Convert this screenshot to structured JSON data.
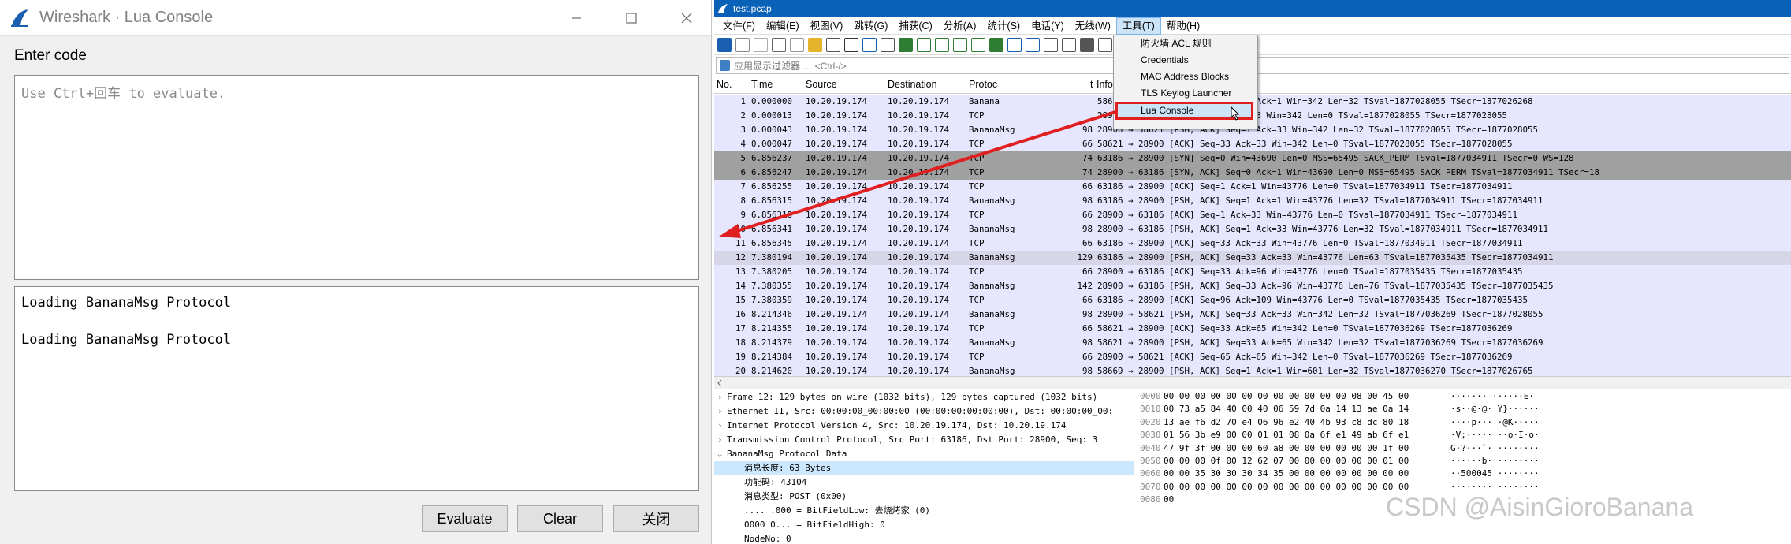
{
  "lua_console": {
    "title": "Wireshark · Lua Console",
    "enter_code_label": "Enter code",
    "code_placeholder": "Use Ctrl+回车 to evaluate.",
    "output_lines": [
      "Loading BananaMsg Protocol",
      "Loading BananaMsg Protocol"
    ],
    "buttons": {
      "evaluate": "Evaluate",
      "clear": "Clear",
      "close": "关闭"
    }
  },
  "wireshark": {
    "title": "test.pcap",
    "menu": [
      "文件(F)",
      "编辑(E)",
      "视图(V)",
      "跳转(G)",
      "捕获(C)",
      "分析(A)",
      "统计(S)",
      "电话(Y)",
      "无线(W)",
      "工具(T)",
      "帮助(H)"
    ],
    "active_menu": "工具(T)",
    "filter_placeholder": "应用显示过滤器 … <Ctrl-/>",
    "tools_menu": [
      "防火墙 ACL 规则",
      "Credentials",
      "MAC Address Blocks",
      "TLS Keylog Launcher",
      "Lua Console"
    ],
    "columns": [
      "No.",
      "Time",
      "Source",
      "Destination",
      "Protoc",
      "t",
      "Info"
    ],
    "packets": [
      {
        "no": "1",
        "time": "0.000000",
        "src": "10.20.19.174",
        "dst": "10.20.19.174",
        "proto": "Banana",
        "len": "",
        "info": "58621 → 28900 [PSH, ACK] Seq=1 Ack=1 Win=342 Len=32 TSval=1877028055 TSecr=1877026268",
        "style": "normal"
      },
      {
        "no": "2",
        "time": "0.000013",
        "src": "10.20.19.174",
        "dst": "10.20.19.174",
        "proto": "TCP",
        "len": "",
        "info": "28900 → 58621 [ACK] Seq=1 Ack=33 Win=342 Len=0 TSval=1877028055 TSecr=1877028055",
        "style": "normal"
      },
      {
        "no": "3",
        "time": "0.000043",
        "src": "10.20.19.174",
        "dst": "10.20.19.174",
        "proto": "BananaMsg",
        "len": "98",
        "info": "28900 → 58621 [PSH, ACK] Seq=1 Ack=33 Win=342 Len=32 TSval=1877028055 TSecr=1877028055",
        "style": "normal"
      },
      {
        "no": "4",
        "time": "0.000047",
        "src": "10.20.19.174",
        "dst": "10.20.19.174",
        "proto": "TCP",
        "len": "66",
        "info": "58621 → 28900 [ACK] Seq=33 Ack=33 Win=342 Len=0 TSval=1877028055 TSecr=1877028055",
        "style": "normal"
      },
      {
        "no": "5",
        "time": "6.856237",
        "src": "10.20.19.174",
        "dst": "10.20.19.174",
        "proto": "TCP",
        "len": "74",
        "info": "63186 → 28900 [SYN] Seq=0 Win=43690 Len=0 MSS=65495 SACK_PERM TSval=1877034911 TSecr=0 WS=128",
        "style": "gray"
      },
      {
        "no": "6",
        "time": "6.856247",
        "src": "10.20.19.174",
        "dst": "10.20.19.174",
        "proto": "TCP",
        "len": "74",
        "info": "28900 → 63186 [SYN, ACK] Seq=0 Ack=1 Win=43690 Len=0 MSS=65495 SACK_PERM TSval=1877034911 TSecr=18",
        "style": "gray"
      },
      {
        "no": "7",
        "time": "6.856255",
        "src": "10.20.19.174",
        "dst": "10.20.19.174",
        "proto": "TCP",
        "len": "66",
        "info": "63186 → 28900 [ACK] Seq=1 Ack=1 Win=43776 Len=0 TSval=1877034911 TSecr=1877034911",
        "style": "normal"
      },
      {
        "no": "8",
        "time": "6.856315",
        "src": "10.20.19.174",
        "dst": "10.20.19.174",
        "proto": "BananaMsg",
        "len": "98",
        "info": "63186 → 28900 [PSH, ACK] Seq=1 Ack=1 Win=43776 Len=32 TSval=1877034911 TSecr=1877034911",
        "style": "normal"
      },
      {
        "no": "9",
        "time": "6.856318",
        "src": "10.20.19.174",
        "dst": "10.20.19.174",
        "proto": "TCP",
        "len": "66",
        "info": "28900 → 63186 [ACK] Seq=1 Ack=33 Win=43776 Len=0 TSval=1877034911 TSecr=1877034911",
        "style": "normal"
      },
      {
        "no": "10",
        "time": "6.856341",
        "src": "10.20.19.174",
        "dst": "10.20.19.174",
        "proto": "BananaMsg",
        "len": "98",
        "info": "28900 → 63186 [PSH, ACK] Seq=1 Ack=33 Win=43776 Len=32 TSval=1877034911 TSecr=1877034911",
        "style": "normal"
      },
      {
        "no": "11",
        "time": "6.856345",
        "src": "10.20.19.174",
        "dst": "10.20.19.174",
        "proto": "TCP",
        "len": "66",
        "info": "63186 → 28900 [ACK] Seq=33 Ack=33 Win=43776 Len=0 TSval=1877034911 TSecr=1877034911",
        "style": "normal"
      },
      {
        "no": "12",
        "time": "7.380194",
        "src": "10.20.19.174",
        "dst": "10.20.19.174",
        "proto": "BananaMsg",
        "len": "129",
        "info": "63186 → 28900 [PSH, ACK] Seq=33 Ack=33 Win=43776 Len=63 TSval=1877035435 TSecr=1877034911",
        "style": "sel"
      },
      {
        "no": "13",
        "time": "7.380205",
        "src": "10.20.19.174",
        "dst": "10.20.19.174",
        "proto": "TCP",
        "len": "66",
        "info": "28900 → 63186 [ACK] Seq=33 Ack=96 Win=43776 Len=0 TSval=1877035435 TSecr=1877035435",
        "style": "normal"
      },
      {
        "no": "14",
        "time": "7.380355",
        "src": "10.20.19.174",
        "dst": "10.20.19.174",
        "proto": "BananaMsg",
        "len": "142",
        "info": "28900 → 63186 [PSH, ACK] Seq=33 Ack=96 Win=43776 Len=76 TSval=1877035435 TSecr=1877035435",
        "style": "normal"
      },
      {
        "no": "15",
        "time": "7.380359",
        "src": "10.20.19.174",
        "dst": "10.20.19.174",
        "proto": "TCP",
        "len": "66",
        "info": "63186 → 28900 [ACK] Seq=96 Ack=109 Win=43776 Len=0 TSval=1877035435 TSecr=1877035435",
        "style": "normal"
      },
      {
        "no": "16",
        "time": "8.214346",
        "src": "10.20.19.174",
        "dst": "10.20.19.174",
        "proto": "BananaMsg",
        "len": "98",
        "info": "28900 → 58621 [PSH, ACK] Seq=33 Ack=33 Win=342 Len=32 TSval=1877036269 TSecr=1877028055",
        "style": "normal"
      },
      {
        "no": "17",
        "time": "8.214355",
        "src": "10.20.19.174",
        "dst": "10.20.19.174",
        "proto": "TCP",
        "len": "66",
        "info": "58621 → 28900 [ACK] Seq=33 Ack=65 Win=342 Len=0 TSval=1877036269 TSecr=1877036269",
        "style": "normal"
      },
      {
        "no": "18",
        "time": "8.214379",
        "src": "10.20.19.174",
        "dst": "10.20.19.174",
        "proto": "BananaMsg",
        "len": "98",
        "info": "58621 → 28900 [PSH, ACK] Seq=33 Ack=65 Win=342 Len=32 TSval=1877036269 TSecr=1877036269",
        "style": "normal"
      },
      {
        "no": "19",
        "time": "8.214384",
        "src": "10.20.19.174",
        "dst": "10.20.19.174",
        "proto": "TCP",
        "len": "66",
        "info": "28900 → 58621 [ACK] Seq=65 Ack=65 Win=342 Len=0 TSval=1877036269 TSecr=1877036269",
        "style": "normal"
      },
      {
        "no": "20",
        "time": "8.214620",
        "src": "10.20.19.174",
        "dst": "10.20.19.174",
        "proto": "BananaMsg",
        "len": "98",
        "info": "58669 → 28900 [PSH, ACK] Seq=1 Ack=1 Win=601 Len=32 TSval=1877036270 TSecr=1877026765",
        "style": "normal"
      }
    ],
    "detail": [
      {
        "text": "Frame 12: 129 bytes on wire (1032 bits), 129 bytes captured (1032 bits)",
        "indent": 0,
        "arrow": "›",
        "hl": false
      },
      {
        "text": "Ethernet II, Src: 00:00:00_00:00:00 (00:00:00:00:00:00), Dst: 00:00:00_00:",
        "indent": 0,
        "arrow": "›",
        "hl": false
      },
      {
        "text": "Internet Protocol Version 4, Src: 10.20.19.174, Dst: 10.20.19.174",
        "indent": 0,
        "arrow": "›",
        "hl": false
      },
      {
        "text": "Transmission Control Protocol, Src Port: 63186, Dst Port: 28900, Seq: 3",
        "indent": 0,
        "arrow": "›",
        "hl": false
      },
      {
        "text": "BananaMsg Protocol Data",
        "indent": 0,
        "arrow": "⌄",
        "hl": false
      },
      {
        "text": "消息长度: 63 Bytes",
        "indent": 1,
        "arrow": "",
        "hl": true
      },
      {
        "text": "功能码: 43104",
        "indent": 1,
        "arrow": "",
        "hl": false
      },
      {
        "text": "消息类型: POST (0x00)",
        "indent": 1,
        "arrow": "",
        "hl": false
      },
      {
        "text": ".... .000 = BitFieldLow: 去烧烤家 (0)",
        "indent": 1,
        "arrow": "",
        "hl": false
      },
      {
        "text": "0000 0... = BitFieldHigh: 0",
        "indent": 1,
        "arrow": "",
        "hl": false
      },
      {
        "text": "NodeNo: 0",
        "indent": 1,
        "arrow": "",
        "hl": false
      }
    ],
    "hex": [
      {
        "off": "0000",
        "bytes": "00 00 00 00 00 00 00 00  00 00 00 00 08 00 45 00",
        "ascii": "·······  ······E·"
      },
      {
        "off": "0010",
        "bytes": "00 73 a5 84 40 00 40 06  59 7d 0a 14 13 ae 0a 14",
        "ascii": "·s··@·@· Y}······"
      },
      {
        "off": "0020",
        "bytes": "13 ae f6 d2 70 e4 06 96  e2 40 4b 93 c8 dc 80 18",
        "ascii": "····p··· ·@K·····"
      },
      {
        "off": "0030",
        "bytes": "01 56 3b e9 00 00 01 01  08 0a 6f e1 49 ab 6f e1",
        "ascii": "·V;····· ··o·I·o·"
      },
      {
        "off": "0040",
        "bytes": "47 9f 3f 00 00 00 60 a8  00 00 00 00 00 00 1f 00",
        "ascii": "G·?···`· ········"
      },
      {
        "off": "0050",
        "bytes": "00 00 00 0f 00 12 62 07  00 00 00 00 00 00 01 00",
        "ascii": "······b· ········"
      },
      {
        "off": "0060",
        "bytes": "00 00 35 30 30 30 34 35  00 00 00 00 00 00 00 00",
        "ascii": "··500045 ········"
      },
      {
        "off": "0070",
        "bytes": "00 00 00 00 00 00 00 00  00 00 00 00 00 00 00 00",
        "ascii": "········ ········"
      },
      {
        "off": "0080",
        "bytes": "00",
        "ascii": ""
      }
    ]
  },
  "watermark": "CSDN @AisinGioroBanana",
  "colors": {
    "titlebar": "#0a61b8",
    "row_normal": "#e7e6ff",
    "row_gray": "#a0a0a0",
    "row_selected": "#d6d6e8",
    "highlight_border": "#e02020",
    "arrow": "#e02020"
  }
}
